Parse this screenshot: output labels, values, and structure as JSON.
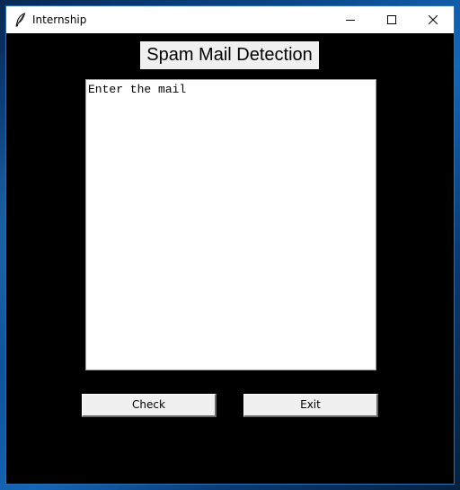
{
  "window": {
    "title": "Internship",
    "app_icon": "feather-icon",
    "controls": [
      "minimize-icon",
      "maximize-icon",
      "close-icon"
    ]
  },
  "main": {
    "heading": "Spam Mail Detection",
    "mail_input_text": "Enter the mail",
    "check_label": "Check",
    "exit_label": "Exit"
  },
  "colors": {
    "background": "#000000",
    "titlebar": "#ffffff",
    "button_face": "#f0f0f0",
    "heading_bg": "#f0f0f0"
  }
}
